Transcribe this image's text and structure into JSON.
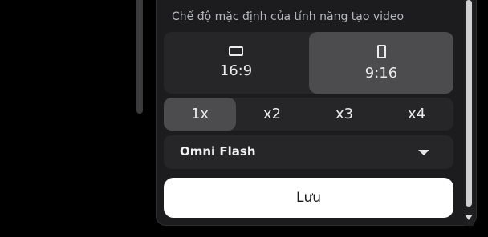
{
  "settings": {
    "video_mode_label": "Chế độ mặc định của tính năng tạo video",
    "aspect_ratios": [
      {
        "label": "16:9",
        "icon": "landscape-rect-icon",
        "selected": false
      },
      {
        "label": "9:16",
        "icon": "portrait-rect-icon",
        "selected": true
      }
    ],
    "multipliers": [
      {
        "label": "1x",
        "selected": true
      },
      {
        "label": "x2",
        "selected": false
      },
      {
        "label": "x3",
        "selected": false
      },
      {
        "label": "x4",
        "selected": false
      }
    ],
    "model_select": {
      "value": "Omni Flash",
      "icon": "chevron-down-icon"
    },
    "save_label": "Lưu"
  },
  "colors": {
    "panel_bg": "#1c1c1e",
    "segment_bg": "#262628",
    "selected_bg": "#4c4c4f",
    "button_bg": "#ffffff",
    "text_primary": "#ececee",
    "text_muted": "#b7b9bd"
  }
}
